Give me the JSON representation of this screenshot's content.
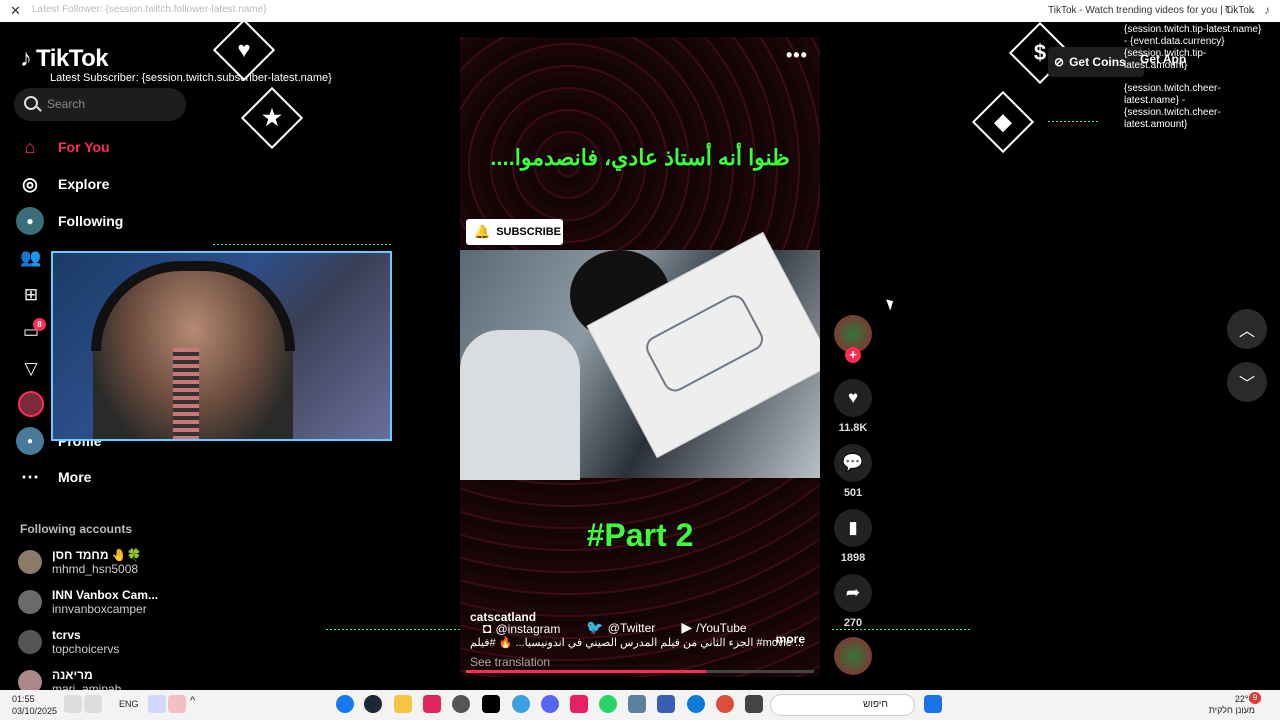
{
  "browser": {
    "tab_title": "TikTok - Watch trending videos for you | TikTok",
    "ghost_text": "Latest Follower: {session.twitch.follower-latest.name}"
  },
  "sidebar": {
    "logo": "TikTok",
    "subscriber_overlay": "Latest Subscriber: {session.twitch.subscriber-latest.name}",
    "search_placeholder": "Search",
    "nav": {
      "for_you": "For You",
      "explore": "Explore",
      "following": "Following",
      "profile": "Profile",
      "more": "More"
    },
    "inbox_badge": "8",
    "following_header": "Following accounts",
    "accounts": [
      {
        "name": "מחמד חסן 🤚🍀",
        "user": "mhmd_hsn5008"
      },
      {
        "name": "INN Vanbox Cam...",
        "user": "innvanboxcamper"
      },
      {
        "name": "tcrvs",
        "user": "topchoicervs"
      },
      {
        "name": "מריאנה",
        "user": "mari_aminah"
      }
    ]
  },
  "video": {
    "title": "ظنوا أنه أستاذ عادي، فانصدموا....",
    "part_label": "#Part 2",
    "subscribe": "SUBSCRIBE",
    "caption_user": "catscatland",
    "caption_text": "الجزء الثاني من فيلم المدرس الصيني في اندونيسيا... 🔥 #فيلم #movie ...",
    "more": "more",
    "see_translation": "See translation",
    "socials": {
      "instagram": "@instagram",
      "twitter": "@Twitter",
      "youtube": "/YouTube"
    },
    "progress": 0.69
  },
  "actions": {
    "likes": "11.8K",
    "comments": "501",
    "saves": "1898",
    "shares": "270"
  },
  "top_right": {
    "get_coins": "Get Coins",
    "get_app": "Get App",
    "tip_overlay": "{session.twitch.tip-latest.name} - {event.data.currency}{session.twitch.tip-latest.amount}",
    "cheer_overlay": "{session.twitch.cheer-latest.name} - {session.twitch.cheer-latest.amount}"
  },
  "taskbar": {
    "time": "01:55",
    "date": "03/10/2025",
    "lang": "ENG",
    "search_placeholder": "חיפוש",
    "weather_line1": "22°C",
    "weather_line2": "מעונן חלקית",
    "notifications": "9"
  },
  "colors": {
    "accent": "#fe2c55",
    "title_green": "#3cff3c"
  }
}
